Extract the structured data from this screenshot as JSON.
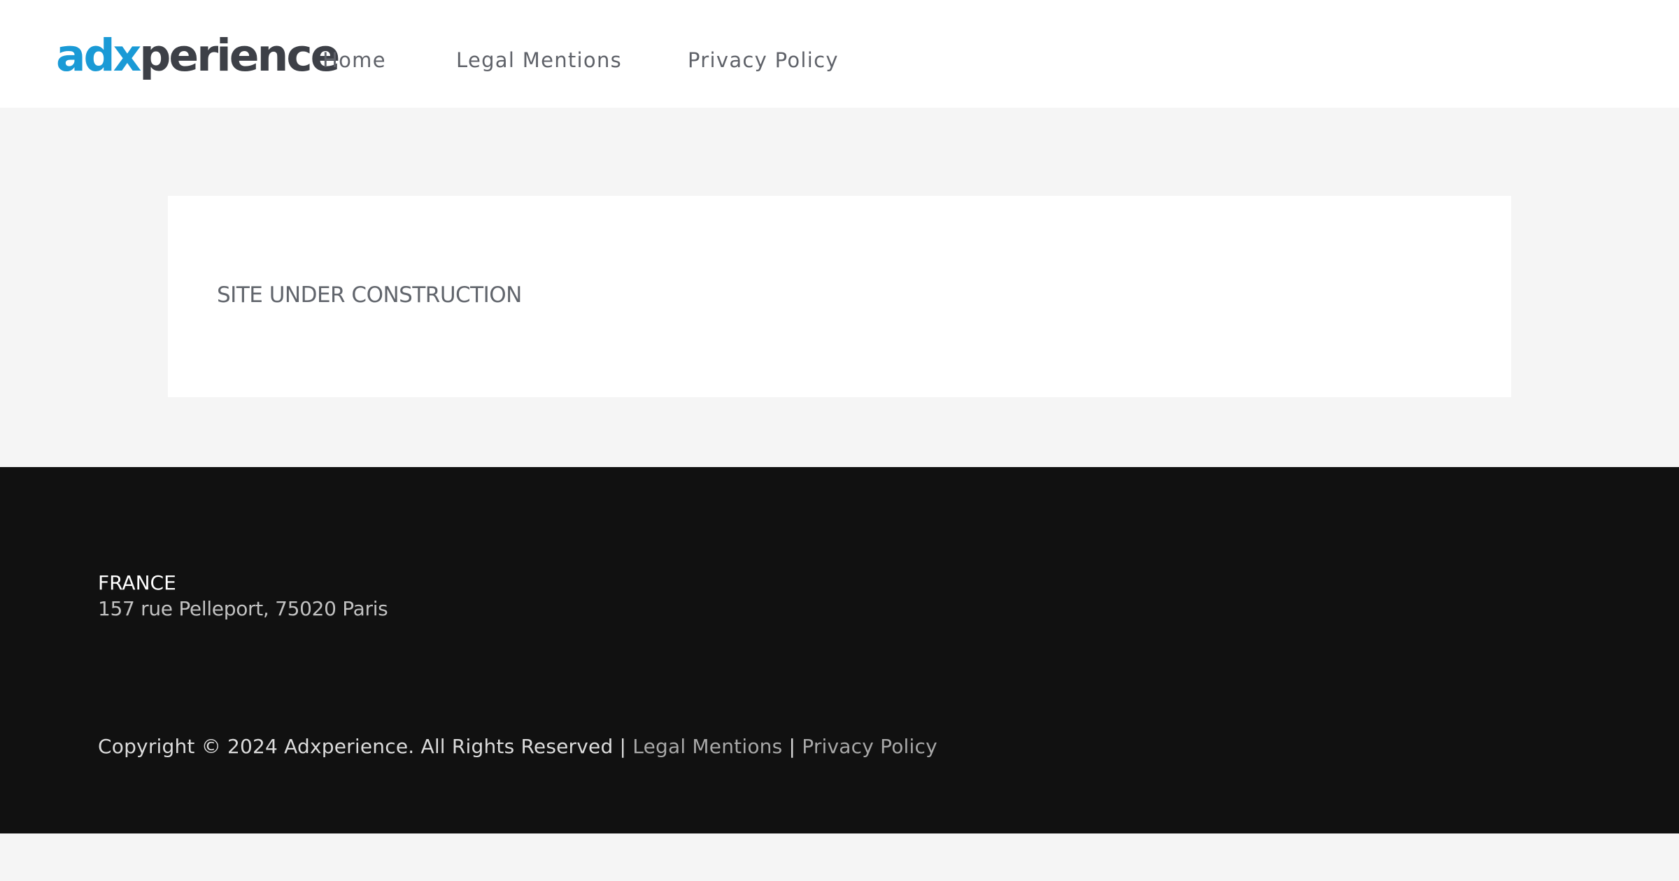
{
  "header": {
    "logo": {
      "accent_text": "adx",
      "rest_text": "perience",
      "accent_color": "#1a9ad6",
      "text_color": "#3d4047"
    },
    "nav": [
      {
        "label": "Home"
      },
      {
        "label": "Legal Mentions"
      },
      {
        "label": "Privacy Policy"
      }
    ]
  },
  "main": {
    "title": "SITE UNDER CONSTRUCTION"
  },
  "footer": {
    "country": "FRANCE",
    "address": "157 rue Pelleport, 75020 Paris",
    "copyright": "Copyright © 2024 Adxperience. All Rights Reserved",
    "separator": "|",
    "links": [
      {
        "label": "Legal Mentions"
      },
      {
        "label": "Privacy Policy"
      }
    ]
  },
  "colors": {
    "page_background": "#f5f5f5",
    "footer_background": "#111111",
    "card_background": "#ffffff"
  }
}
